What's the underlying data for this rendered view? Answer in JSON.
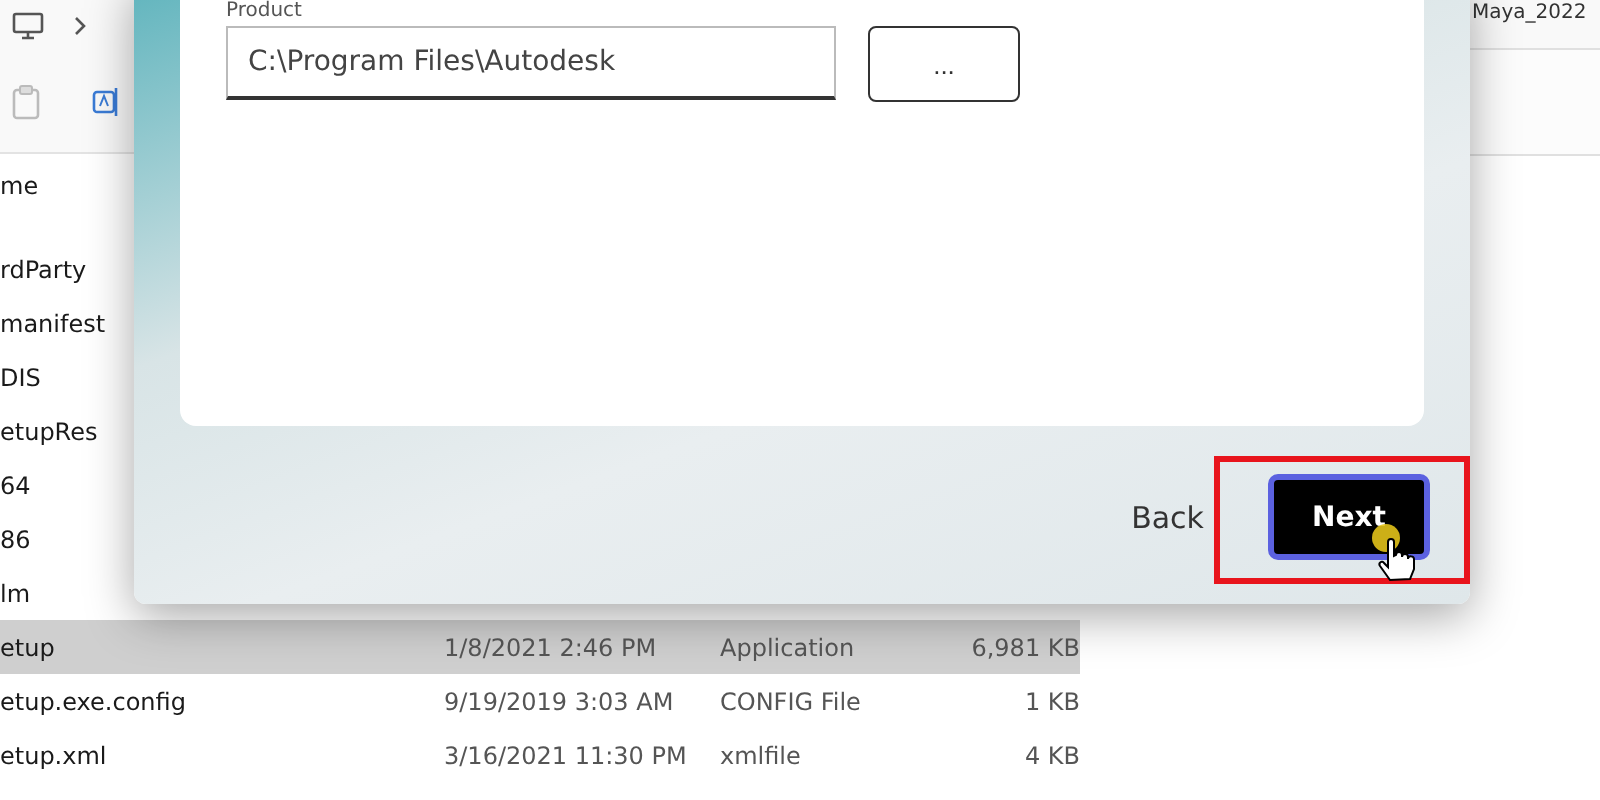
{
  "explorer": {
    "address": "Maya_2022",
    "list_header": "me",
    "rows": [
      {
        "name": "rdParty",
        "selected": false
      },
      {
        "name": "manifest",
        "selected": false
      },
      {
        "name": "DIS",
        "selected": false
      },
      {
        "name": "etupRes",
        "selected": false
      },
      {
        "name": "64",
        "selected": false
      },
      {
        "name": "86",
        "selected": false
      },
      {
        "name": "lm",
        "selected": false
      },
      {
        "name": "etup",
        "date": "1/8/2021 2:46 PM",
        "type": "Application",
        "size": "6,981 KB",
        "selected": true
      },
      {
        "name": "etup.exe.config",
        "date": "9/19/2019 3:03 AM",
        "type": "CONFIG File",
        "size": "1 KB",
        "selected": false
      },
      {
        "name": "etup.xml",
        "date": "3/16/2021 11:30 PM",
        "type": "xmlfile",
        "size": "4 KB",
        "selected": false
      }
    ]
  },
  "dialog": {
    "field_label": "Product",
    "path_value": "C:\\Program Files\\Autodesk",
    "browse_label": "...",
    "back_label": "Back",
    "next_label": "Next",
    "next_highlighted": true
  }
}
